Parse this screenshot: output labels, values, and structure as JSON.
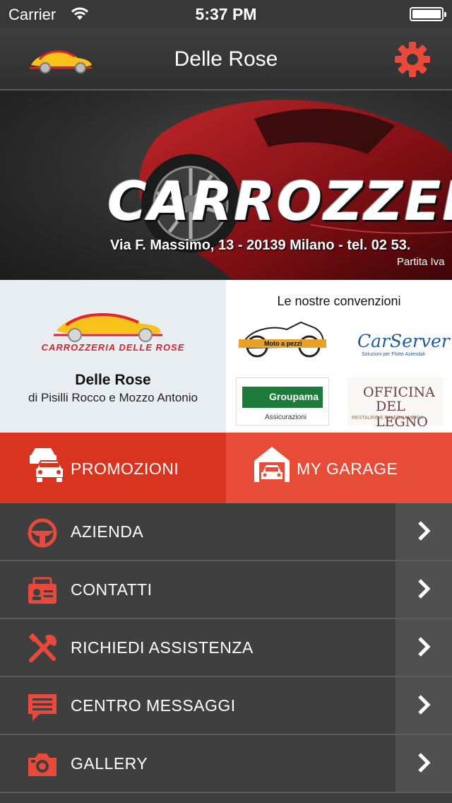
{
  "status_bar": {
    "carrier": "Carrier",
    "time": "5:37 PM"
  },
  "nav": {
    "title": "Delle Rose",
    "logo_icon": "car-logo-icon",
    "settings_icon": "gear-icon"
  },
  "banner": {
    "wordmark": "CARROZZERI",
    "address": "Via F. Massimo, 13 - 20139 Milano - tel. 02 53.",
    "piva": "Partita Iva"
  },
  "info": {
    "logo_text": "CARROZZERIA DELLE ROSE",
    "name": "Delle Rose",
    "subtitle": "di Pisilli Rocco e Mozzo Antonio"
  },
  "conventions": {
    "title": "Le nostre convenzioni",
    "partners": [
      {
        "name": "Moto a pezzi",
        "text": "Moto a pezzi"
      },
      {
        "name": "CarServer",
        "text": "CarServer",
        "tagline": "Soluzioni per Flotte Aziendali"
      },
      {
        "name": "Groupama",
        "text": "Groupama",
        "tagline": "Assicurazioni"
      },
      {
        "name": "Officina del Legno",
        "line1": "OFFICINA",
        "line2": "DEL LEGNO",
        "tagline": "RESTAURO E FALEGNAMERIA"
      }
    ]
  },
  "actions": {
    "promo": {
      "label": "PROMOZIONI",
      "icon": "cars-icon",
      "color": "#d8341f"
    },
    "garage": {
      "label": "MY GARAGE",
      "icon": "garage-icon",
      "color": "#e64c38"
    }
  },
  "menu": [
    {
      "label": "AZIENDA",
      "icon": "steering-wheel-icon"
    },
    {
      "label": "CONTATTI",
      "icon": "contact-card-icon"
    },
    {
      "label": "RICHIEDI ASSISTENZA",
      "icon": "tools-icon"
    },
    {
      "label": "CENTRO MESSAGGI",
      "icon": "message-icon"
    },
    {
      "label": "GALLERY",
      "icon": "camera-icon"
    }
  ],
  "colors": {
    "accent": "#e8493a",
    "dark": "#3f3f3f"
  }
}
